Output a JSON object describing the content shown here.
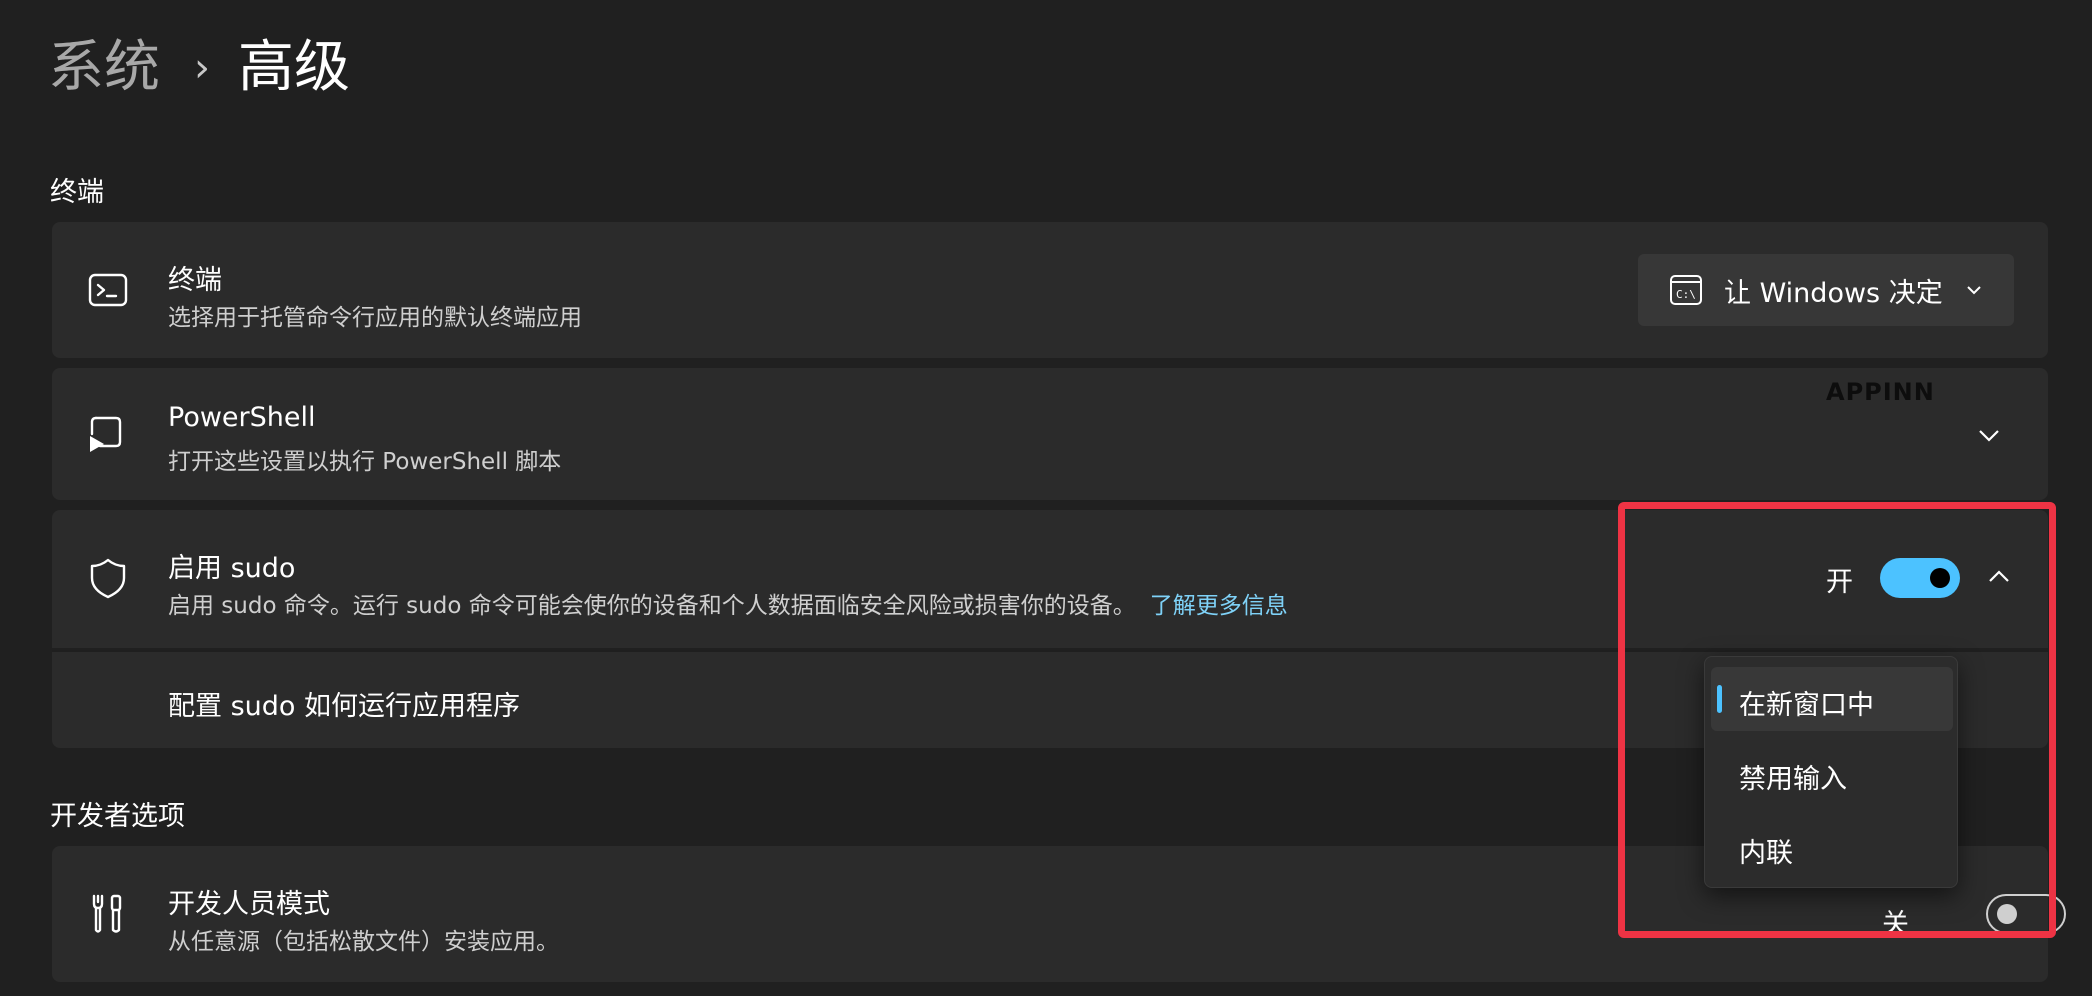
{
  "breadcrumb": {
    "parent": "系统",
    "separator": "›",
    "current": "高级"
  },
  "watermark": "APPINN",
  "sections": {
    "terminal_header": "终端",
    "developer_header": "开发者选项"
  },
  "terminal": {
    "title": "终端",
    "description": "选择用于托管命令行应用的默认终端应用",
    "dropdown_value": "让 Windows 决定",
    "icon": "terminal-icon"
  },
  "powershell": {
    "title": "PowerShell",
    "description": "打开这些设置以执行 PowerShell 脚本",
    "icon": "powershell-icon"
  },
  "sudo": {
    "title": "启用 sudo",
    "description": "启用 sudo 命令。运行 sudo 命令可能会使你的设备和个人数据面临安全风险或损害你的设备。",
    "link": "了解更多信息",
    "toggle_label": "开",
    "toggle_on": true,
    "icon": "shield-icon",
    "config_label": "配置 sudo 如何运行应用程序",
    "options": [
      "在新窗口中",
      "禁用输入",
      "内联"
    ],
    "selected_option": "在新窗口中"
  },
  "developer_mode": {
    "title": "开发人员模式",
    "description": "从任意源（包括松散文件）安装应用。",
    "toggle_label": "关",
    "toggle_on": false,
    "icon": "tools-icon"
  },
  "colors": {
    "background": "#202020",
    "card": "#2b2b2b",
    "accent": "#4cc2ff",
    "link": "#7fd2f8",
    "highlight": "#ee3344"
  }
}
